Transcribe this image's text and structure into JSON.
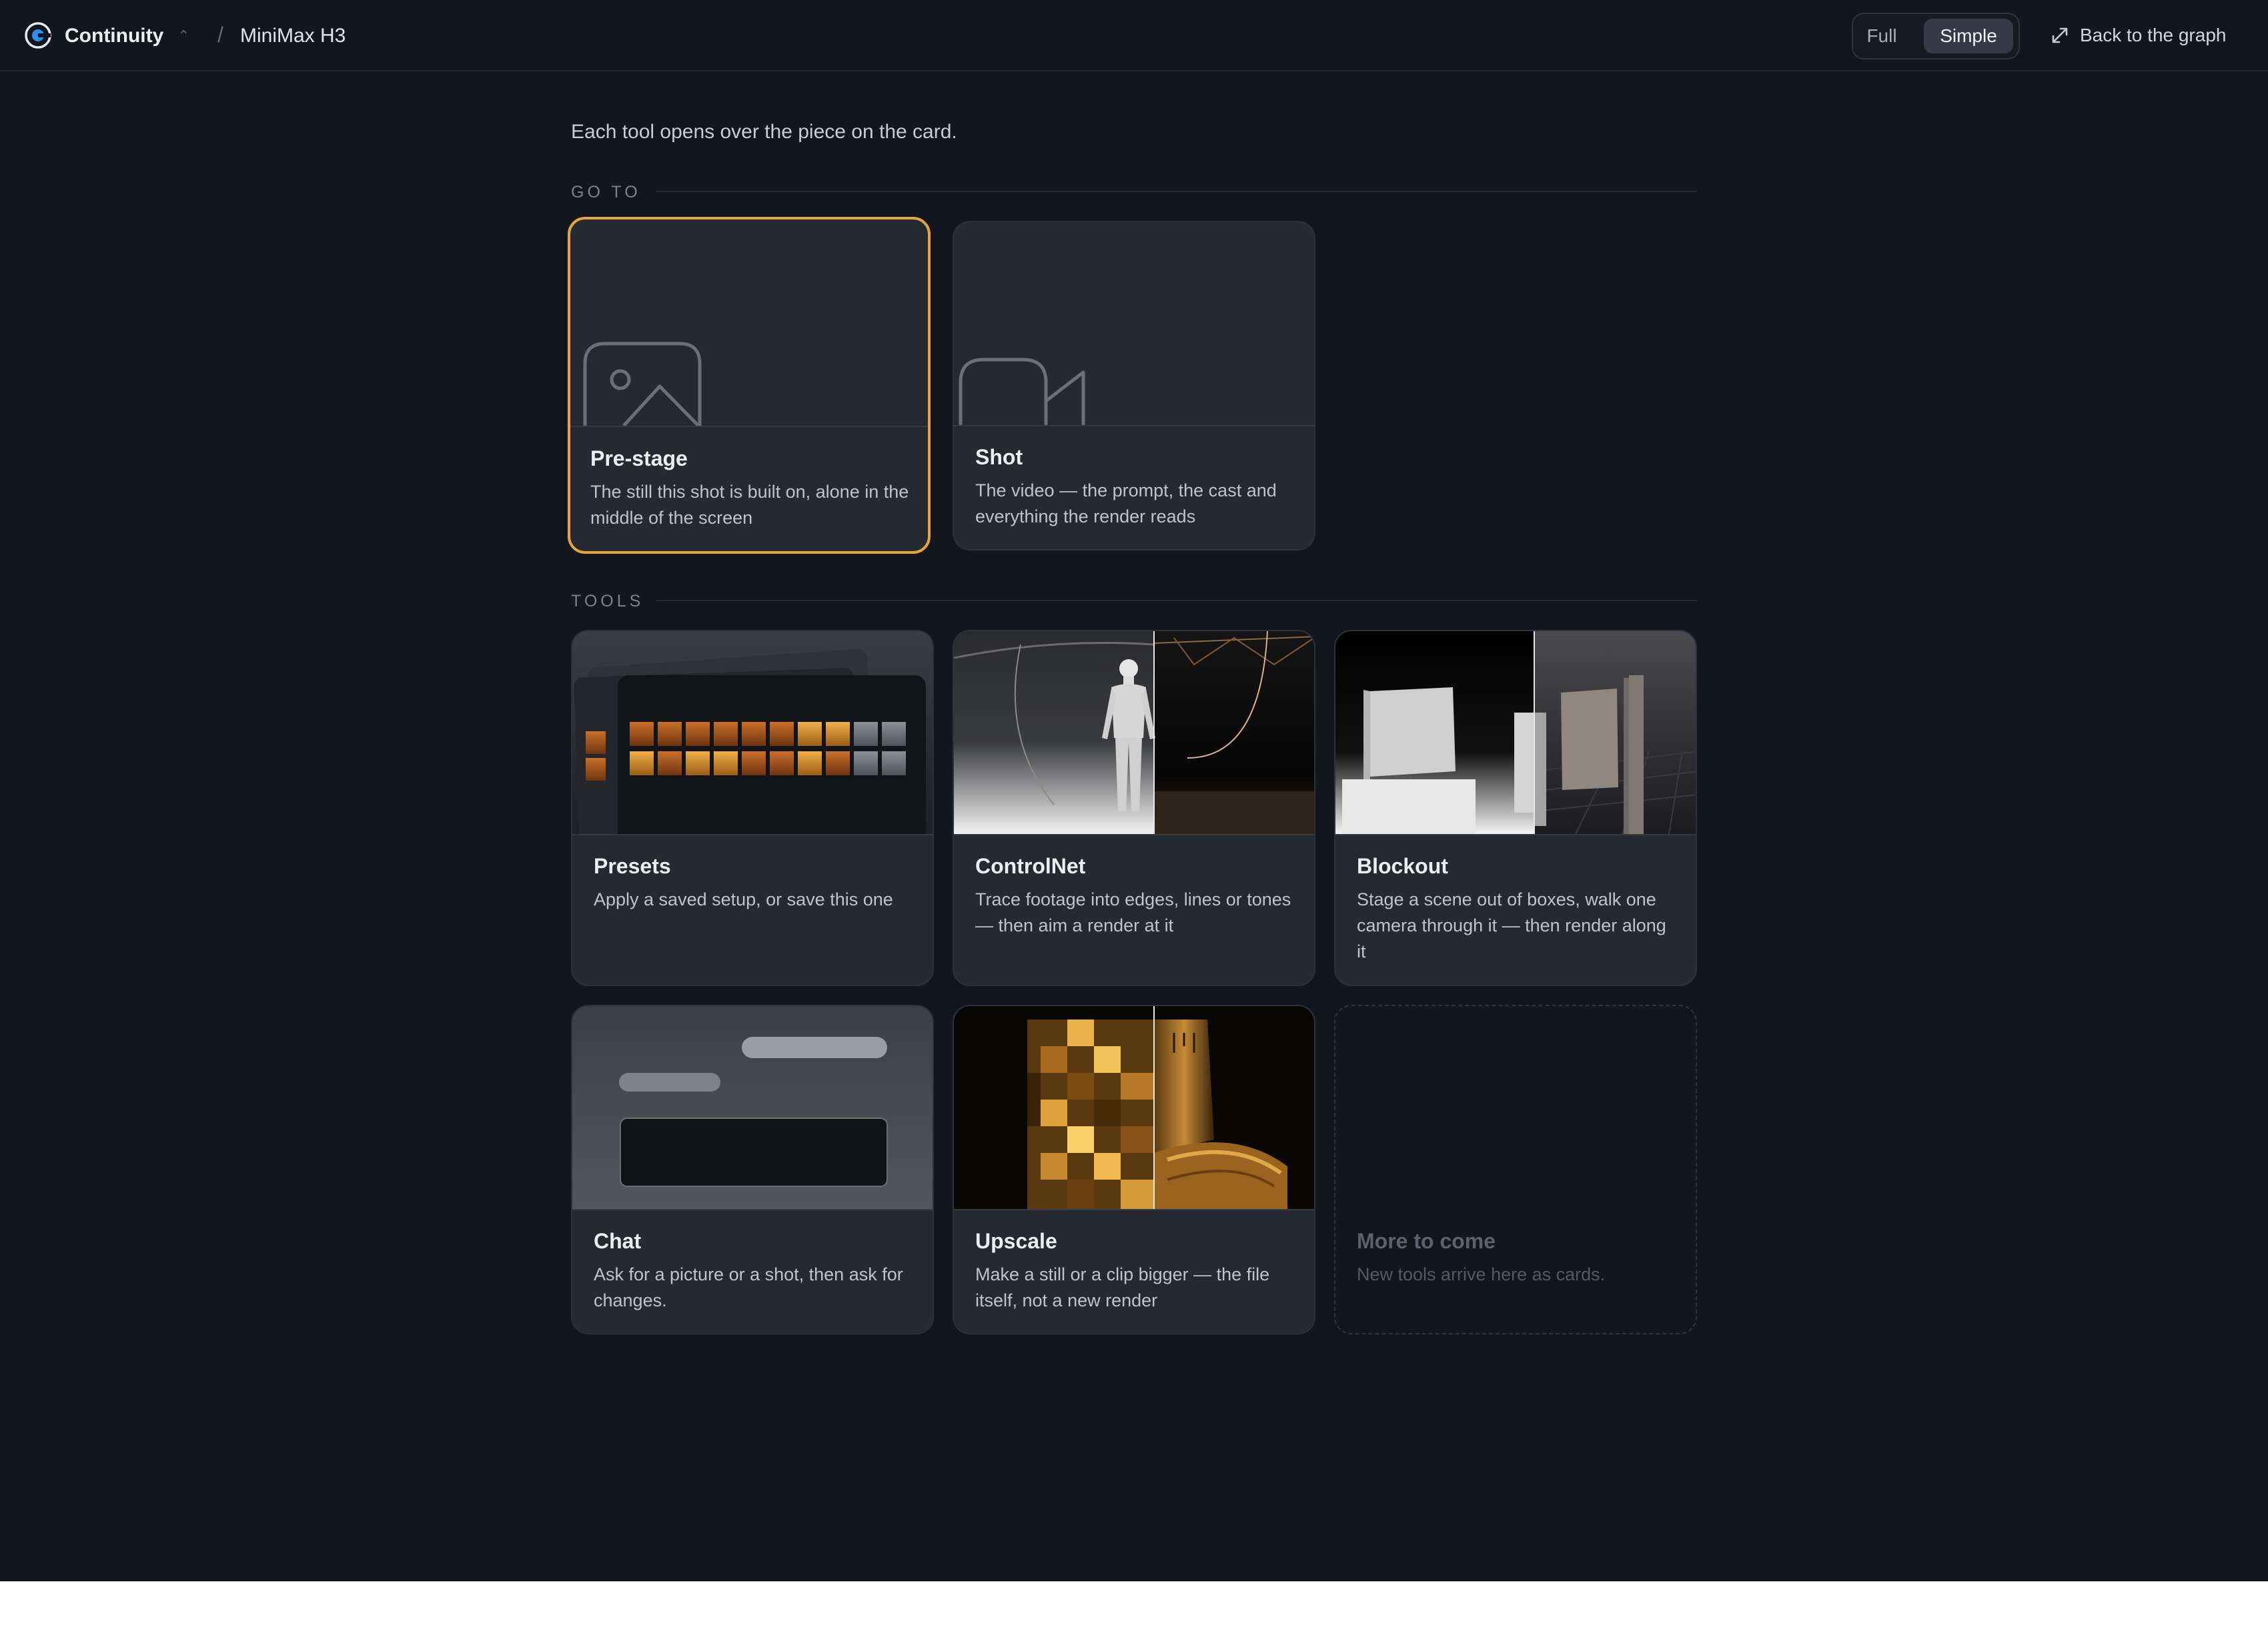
{
  "header": {
    "app_name": "Continuity",
    "caret": "⌃",
    "separator": "/",
    "project": "MiniMax H3",
    "modes": [
      "Full",
      "Simple"
    ],
    "active_mode": "Simple",
    "back_label": "Back to the graph"
  },
  "intro": "Each tool opens over the piece on the card.",
  "sections": {
    "goto": "GO TO",
    "tools": "TOOLS"
  },
  "goto_cards": [
    {
      "title": "Pre-stage",
      "desc": "The still this shot is built on, alone in the middle of the screen",
      "icon": "image-icon",
      "selected": true
    },
    {
      "title": "Shot",
      "desc": "The video — the prompt, the cast and everything the render reads",
      "icon": "video-camera-icon",
      "selected": false
    }
  ],
  "tool_cards": [
    {
      "title": "Presets",
      "desc": "Apply a saved setup, or save this one"
    },
    {
      "title": "ControlNet",
      "desc": "Trace footage into edges, lines or tones — then aim a render at it"
    },
    {
      "title": "Blockout",
      "desc": "Stage a scene out of boxes, walk one camera through it — then render along it"
    },
    {
      "title": "Chat",
      "desc": "Ask for a picture or a shot, then ask for changes."
    },
    {
      "title": "Upscale",
      "desc": "Make a still or a clip bigger — the file itself, not a new render"
    },
    {
      "title": "More to come",
      "desc": "New tools arrive here as cards."
    }
  ],
  "colors": {
    "background": "#13161d",
    "card": "#252931",
    "accent": "#e5a53c"
  }
}
